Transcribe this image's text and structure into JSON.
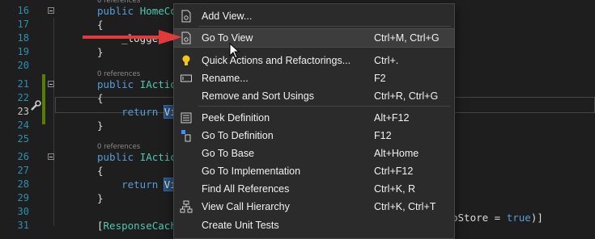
{
  "editor": {
    "lines": [
      {
        "num": "16",
        "tokens": [
          {
            "t": "public ",
            "c": "kw"
          },
          {
            "t": "HomeCont",
            "c": "type"
          }
        ],
        "refs": "0 references"
      },
      {
        "num": "17",
        "tokens": [
          {
            "t": "{",
            "c": ""
          }
        ]
      },
      {
        "num": "18",
        "tokens": [
          {
            "t": "    _logger = ",
            "c": ""
          }
        ]
      },
      {
        "num": "19",
        "tokens": [
          {
            "t": "}",
            "c": ""
          }
        ]
      },
      {
        "num": "20",
        "tokens": []
      },
      {
        "num": "21",
        "tokens": [
          {
            "t": "public ",
            "c": "kw"
          },
          {
            "t": "IActionR",
            "c": "type"
          }
        ],
        "refs": "0 references"
      },
      {
        "num": "22",
        "tokens": [
          {
            "t": "{",
            "c": ""
          }
        ]
      },
      {
        "num": "23",
        "tokens": [
          {
            "t": "    return ",
            "c": "kw"
          },
          {
            "t": "View",
            "c": "sel"
          }
        ]
      },
      {
        "num": "24",
        "tokens": [
          {
            "t": "}",
            "c": ""
          }
        ]
      },
      {
        "num": "25",
        "tokens": []
      },
      {
        "num": "26",
        "tokens": [
          {
            "t": "public ",
            "c": "kw"
          },
          {
            "t": "IActionR",
            "c": "type"
          }
        ],
        "refs": "0 references"
      },
      {
        "num": "27",
        "tokens": [
          {
            "t": "{",
            "c": ""
          }
        ]
      },
      {
        "num": "28",
        "tokens": [
          {
            "t": "    return ",
            "c": "kw"
          },
          {
            "t": "View",
            "c": "sel"
          }
        ]
      },
      {
        "num": "29",
        "tokens": [
          {
            "t": "}",
            "c": ""
          }
        ]
      },
      {
        "num": "30",
        "tokens": []
      },
      {
        "num": "31",
        "tokens": [
          {
            "t": "[",
            "c": ""
          },
          {
            "t": "ResponseCache",
            "c": "type"
          },
          {
            "t": "(",
            "c": ""
          }
        ]
      }
    ],
    "tail_text": "oStore = ",
    "tail_kw": "true",
    "tail_close": ")]"
  },
  "context_menu": {
    "items": [
      {
        "label": "Add View...",
        "shortcut": "",
        "icon": "add-view-icon"
      },
      {
        "label": "Go To View",
        "shortcut": "Ctrl+M, Ctrl+G",
        "icon": "go-to-view-icon",
        "highlighted": true
      },
      {
        "separator": true
      },
      {
        "label": "Quick Actions and Refactorings...",
        "shortcut": "Ctrl+.",
        "icon": "lightbulb-icon"
      },
      {
        "label": "Rename...",
        "shortcut": "F2",
        "icon": "rename-icon"
      },
      {
        "label": "Remove and Sort Usings",
        "shortcut": "Ctrl+R, Ctrl+G",
        "icon": ""
      },
      {
        "separator": true
      },
      {
        "label": "Peek Definition",
        "shortcut": "Alt+F12",
        "icon": "peek-definition-icon"
      },
      {
        "label": "Go To Definition",
        "shortcut": "F12",
        "icon": "go-to-definition-icon"
      },
      {
        "label": "Go To Base",
        "shortcut": "Alt+Home",
        "icon": ""
      },
      {
        "label": "Go To Implementation",
        "shortcut": "Ctrl+F12",
        "icon": ""
      },
      {
        "label": "Find All References",
        "shortcut": "Ctrl+K, R",
        "icon": ""
      },
      {
        "label": "View Call Hierarchy",
        "shortcut": "Ctrl+K, Ctrl+T",
        "icon": "call-hierarchy-icon"
      },
      {
        "label": "Create Unit Tests",
        "shortcut": "",
        "icon": ""
      }
    ]
  },
  "colors": {
    "keyword": "#569cd6",
    "type": "#4ec9b0",
    "selection": "#264f78",
    "annotation_arrow": "#e03a3a"
  }
}
